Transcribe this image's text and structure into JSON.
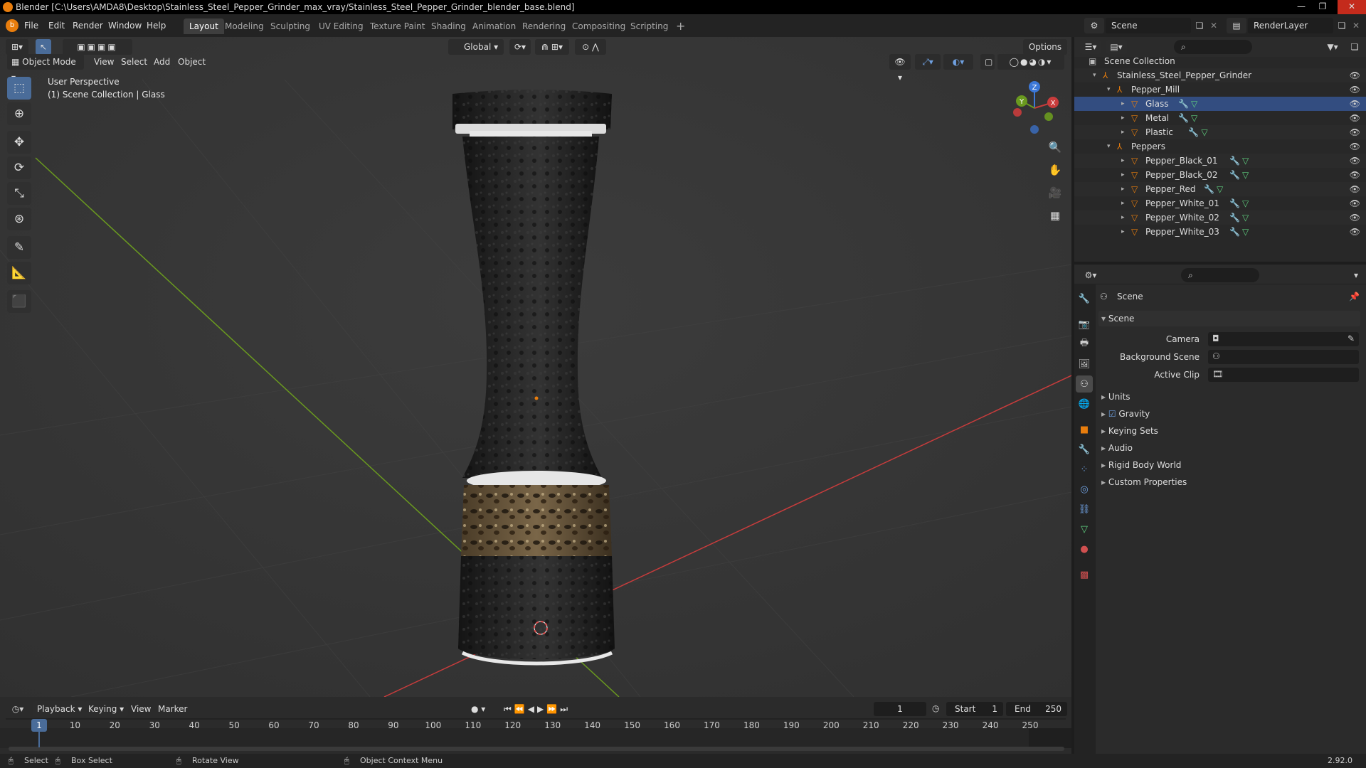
{
  "window": {
    "title": "Blender [C:\\Users\\AMDA8\\Desktop\\Stainless_Steel_Pepper_Grinder_max_vray/Stainless_Steel_Pepper_Grinder_blender_base.blend]"
  },
  "menu": [
    "File",
    "Edit",
    "Render",
    "Window",
    "Help"
  ],
  "workspaces": [
    "Layout",
    "Modeling",
    "Sculpting",
    "UV Editing",
    "Texture Paint",
    "Shading",
    "Animation",
    "Rendering",
    "Compositing",
    "Scripting"
  ],
  "active_workspace": "Layout",
  "scene_selector": {
    "label": "Scene",
    "value": "Scene"
  },
  "renderlayer": "RenderLayer",
  "viewport": {
    "transform_orientation": "Global",
    "options_label": "Options",
    "mode": "Object Mode",
    "menus": [
      "View",
      "Select",
      "Add",
      "Object"
    ],
    "overlay_line1": "User Perspective",
    "overlay_line2": "(1) Scene Collection | Glass",
    "gizmo": {
      "x": "X",
      "y": "Y",
      "z": "Z"
    }
  },
  "tools": [
    "select-box",
    "cursor",
    "move",
    "rotate",
    "scale",
    "transform",
    "annotate",
    "measure",
    "add-cube"
  ],
  "outliner": {
    "root": "Scene Collection",
    "rows": [
      {
        "label": "Stainless_Steel_Pepper_Grinder",
        "depth": 1,
        "type": "empty"
      },
      {
        "label": "Pepper_Mill",
        "depth": 2,
        "type": "empty"
      },
      {
        "label": "Glass",
        "depth": 3,
        "type": "mesh",
        "selected": true
      },
      {
        "label": "Metal",
        "depth": 3,
        "type": "mesh"
      },
      {
        "label": "Plastic",
        "depth": 3,
        "type": "mesh"
      },
      {
        "label": "Peppers",
        "depth": 2,
        "type": "empty"
      },
      {
        "label": "Pepper_Black_01",
        "depth": 3,
        "type": "mesh"
      },
      {
        "label": "Pepper_Black_02",
        "depth": 3,
        "type": "mesh"
      },
      {
        "label": "Pepper_Red",
        "depth": 3,
        "type": "mesh"
      },
      {
        "label": "Pepper_White_01",
        "depth": 3,
        "type": "mesh"
      },
      {
        "label": "Pepper_White_02",
        "depth": 3,
        "type": "mesh"
      },
      {
        "label": "Pepper_White_03",
        "depth": 3,
        "type": "mesh"
      }
    ]
  },
  "properties": {
    "context": "Scene",
    "panel_title": "Scene",
    "fields": [
      {
        "label": "Camera",
        "value": ""
      },
      {
        "label": "Background Scene",
        "value": ""
      },
      {
        "label": "Active Clip",
        "value": ""
      }
    ],
    "panels": [
      "Units",
      "Gravity",
      "Keying Sets",
      "Audio",
      "Rigid Body World",
      "Custom Properties"
    ],
    "gravity_checked": true
  },
  "timeline": {
    "menus": [
      "Playback",
      "Keying",
      "View",
      "Marker"
    ],
    "current_frame": "1",
    "start_label": "Start",
    "start": "1",
    "end_label": "End",
    "end": "250",
    "ticks": [
      "1",
      "10",
      "20",
      "30",
      "40",
      "50",
      "60",
      "70",
      "80",
      "90",
      "100",
      "110",
      "120",
      "130",
      "140",
      "150",
      "160",
      "170",
      "180",
      "190",
      "200",
      "210",
      "220",
      "230",
      "240",
      "250"
    ]
  },
  "statusbar": {
    "items": [
      "Select",
      "Box Select",
      "Rotate View",
      "Object Context Menu"
    ],
    "version": "2.92.0"
  },
  "colors": {
    "accent": "#4a6c99",
    "selection": "#334d80",
    "viewport_bg": "#393939",
    "x_axis": "#c83c3c",
    "y_axis": "#6a9a1f",
    "z_axis": "#3c78d8",
    "object_orange": "#e87d0d"
  }
}
